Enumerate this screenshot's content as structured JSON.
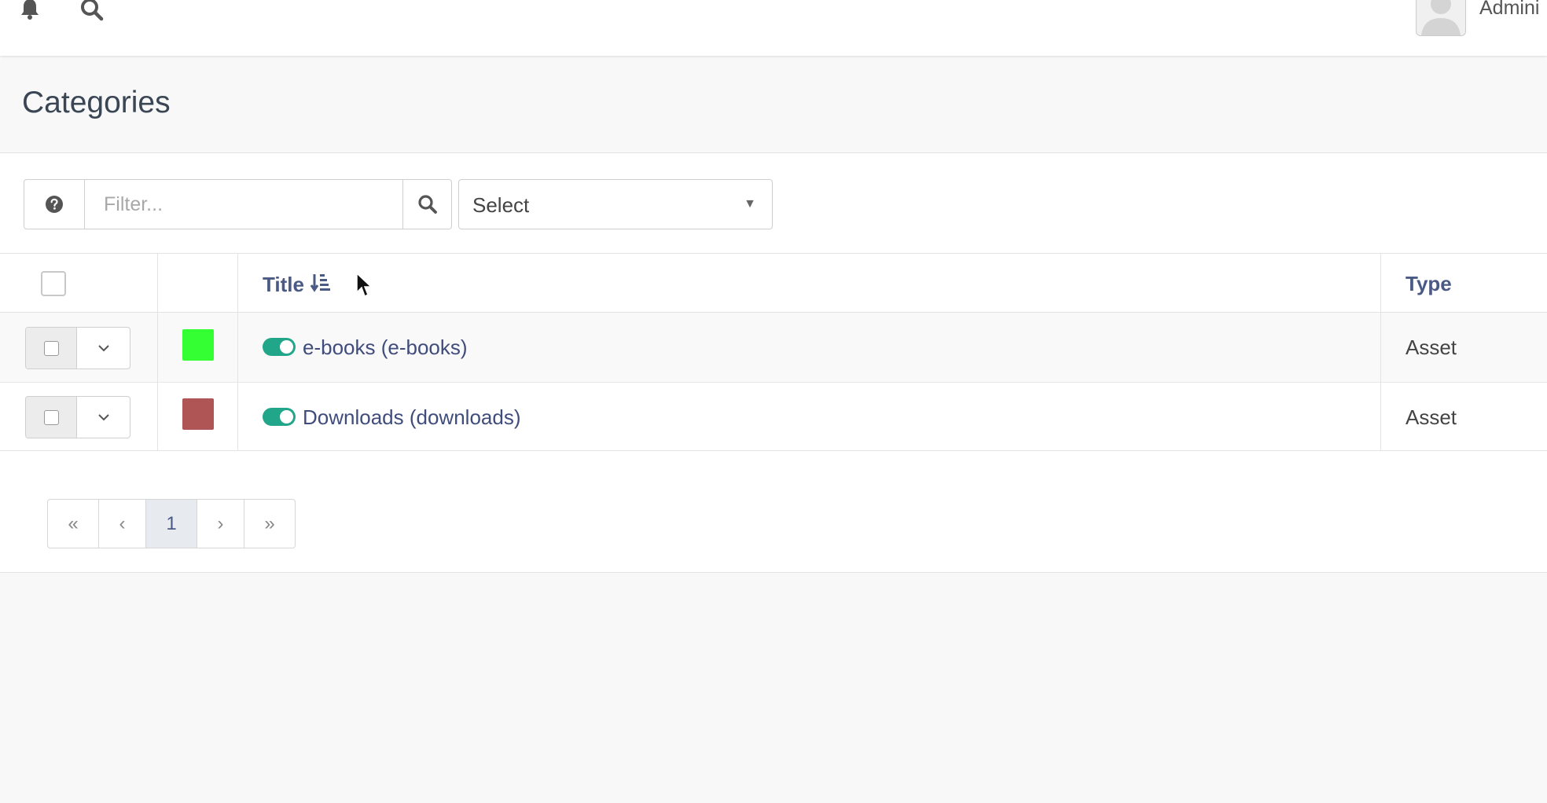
{
  "topbar": {
    "notifications_icon": "bell-icon",
    "search_icon": "search-icon",
    "user_name": "Admini"
  },
  "page": {
    "title": "Categories"
  },
  "toolbar": {
    "help_icon": "question-circle-icon",
    "filter_placeholder": "Filter...",
    "filter_value": "",
    "search_icon": "search-icon",
    "select_value": "Select"
  },
  "table": {
    "columns": {
      "title": "Title",
      "type": "Type"
    },
    "sort_icon": "sort-amount-asc-icon",
    "rows": [
      {
        "label": "e-books (e-books)",
        "type": "Asset",
        "color": "#33ff33",
        "published": true
      },
      {
        "label": "Downloads (downloads)",
        "type": "Asset",
        "color": "#b05555",
        "published": true
      }
    ]
  },
  "pagination": {
    "first": "«",
    "prev": "‹",
    "current_page": "1",
    "next": "›",
    "last": "»"
  },
  "colors": {
    "accent": "#4a5a85",
    "toggle_on": "#22a68a"
  }
}
